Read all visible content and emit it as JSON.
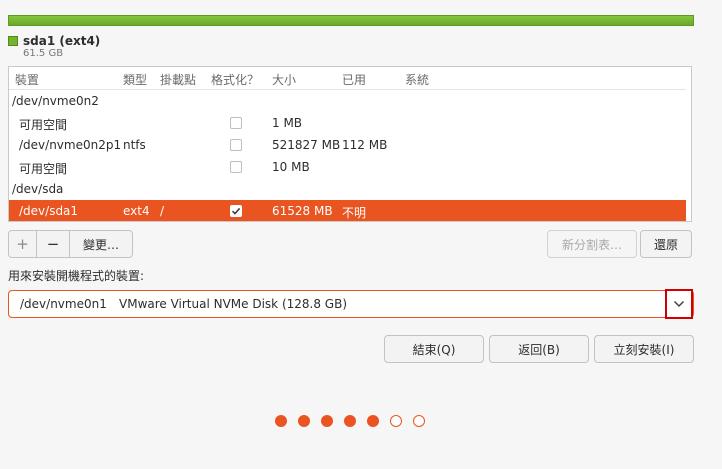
{
  "partition_bar": {
    "color": "#73b42e"
  },
  "legend": {
    "name": "sda1 (ext4)",
    "size": "61.5 GB"
  },
  "table": {
    "headers": [
      "裝置",
      "類型",
      "掛載點",
      "格式化？",
      "大小",
      "已用",
      "系統"
    ],
    "rows": [
      {
        "device": "/dev/nvme0n2",
        "type": "",
        "mount": "",
        "format": null,
        "size": "",
        "used": "",
        "system": "",
        "header": true
      },
      {
        "device": "可用空間",
        "type": "",
        "mount": "",
        "format": false,
        "size": "1 MB",
        "used": "",
        "system": ""
      },
      {
        "device": "/dev/nvme0n2p1",
        "type": "ntfs",
        "mount": "",
        "format": false,
        "size": "521827 MB",
        "used": "112 MB",
        "system": ""
      },
      {
        "device": "可用空間",
        "type": "",
        "mount": "",
        "format": false,
        "size": "10 MB",
        "used": "",
        "system": ""
      },
      {
        "device": "/dev/sda",
        "type": "",
        "mount": "",
        "format": null,
        "size": "",
        "used": "",
        "system": "",
        "header": true
      },
      {
        "device": "/dev/sda1",
        "type": "ext4",
        "mount": "/",
        "format": true,
        "size": "61528 MB",
        "used": "不明",
        "system": "",
        "selected": true
      }
    ]
  },
  "toolbar": {
    "add_label": "+",
    "remove_label": "−",
    "change_label": "變更…",
    "new_table_label": "新分割表…",
    "revert_label": "還原"
  },
  "boot": {
    "label": "用來安裝開機程式的裝置:",
    "device": "/dev/nvme0n1",
    "description": "VMware Virtual NVMe Disk (128.8 GB)"
  },
  "actions": {
    "quit_label": "結束(Q)",
    "back_label": "返回(B)",
    "install_label": "立刻安裝(I)"
  },
  "progress": {
    "total": 7,
    "current": 5
  },
  "colors": {
    "accent": "#e95420",
    "highlight_box": "#d10000"
  }
}
